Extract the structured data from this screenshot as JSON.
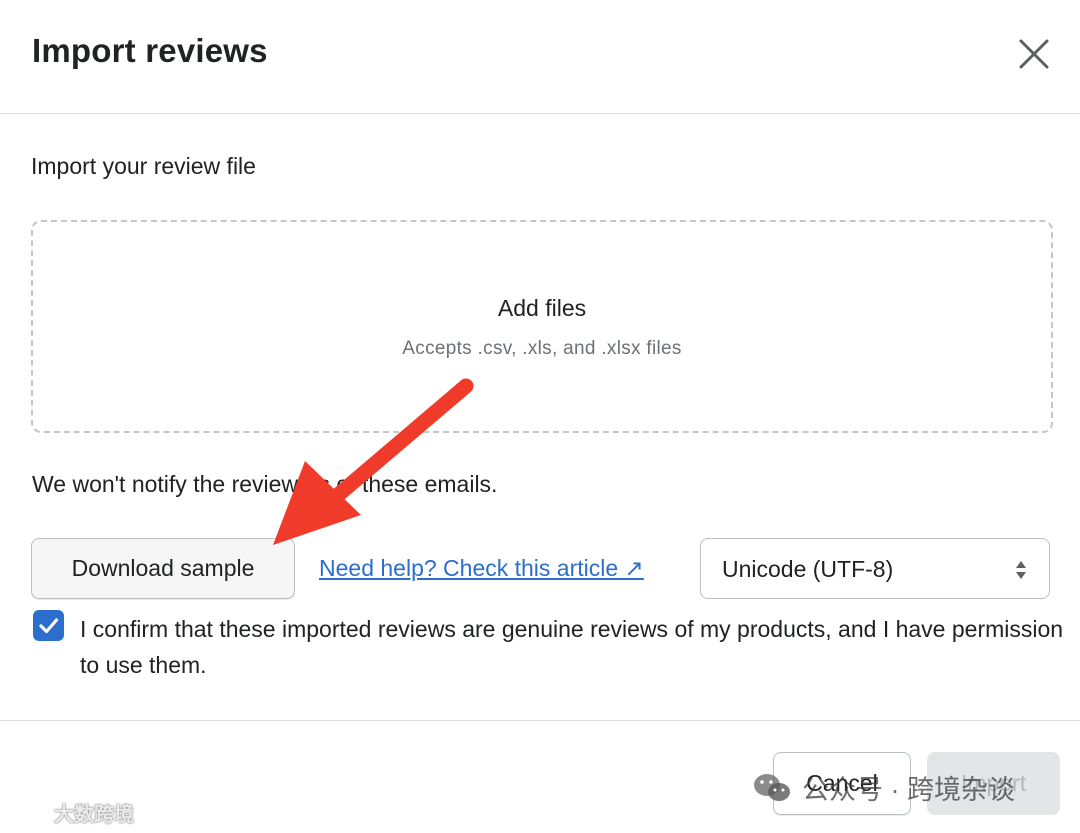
{
  "dialog": {
    "title": "Import reviews",
    "close_icon": "close-icon"
  },
  "upload": {
    "section_label": "Import your review file",
    "dropzone_title": "Add files",
    "dropzone_hint": "Accepts .csv, .xls, and .xlsx files"
  },
  "notice": "We won't notify the reviewers of these emails.",
  "actions": {
    "download_sample_label": "Download sample",
    "help_link_label": "Need help? Check this article ↗",
    "encoding": {
      "selected": "Unicode (UTF-8)",
      "icon": "select-arrows-icon"
    }
  },
  "confirm": {
    "checked": true,
    "label": "I confirm that these imported reviews are genuine reviews of my products, and I have permission to use them."
  },
  "footer": {
    "cancel_label": "Cancel",
    "import_label": "Import",
    "import_disabled": true
  },
  "annotation": {
    "arrow_color": "#f03a2a"
  },
  "watermarks": {
    "left_text": "大数跨境",
    "right_text": "公众号 · 跨境杂谈"
  },
  "colors": {
    "accent": "#2c6ecb",
    "text": "#202223",
    "muted": "#6d7175",
    "border": "#babfc3"
  }
}
